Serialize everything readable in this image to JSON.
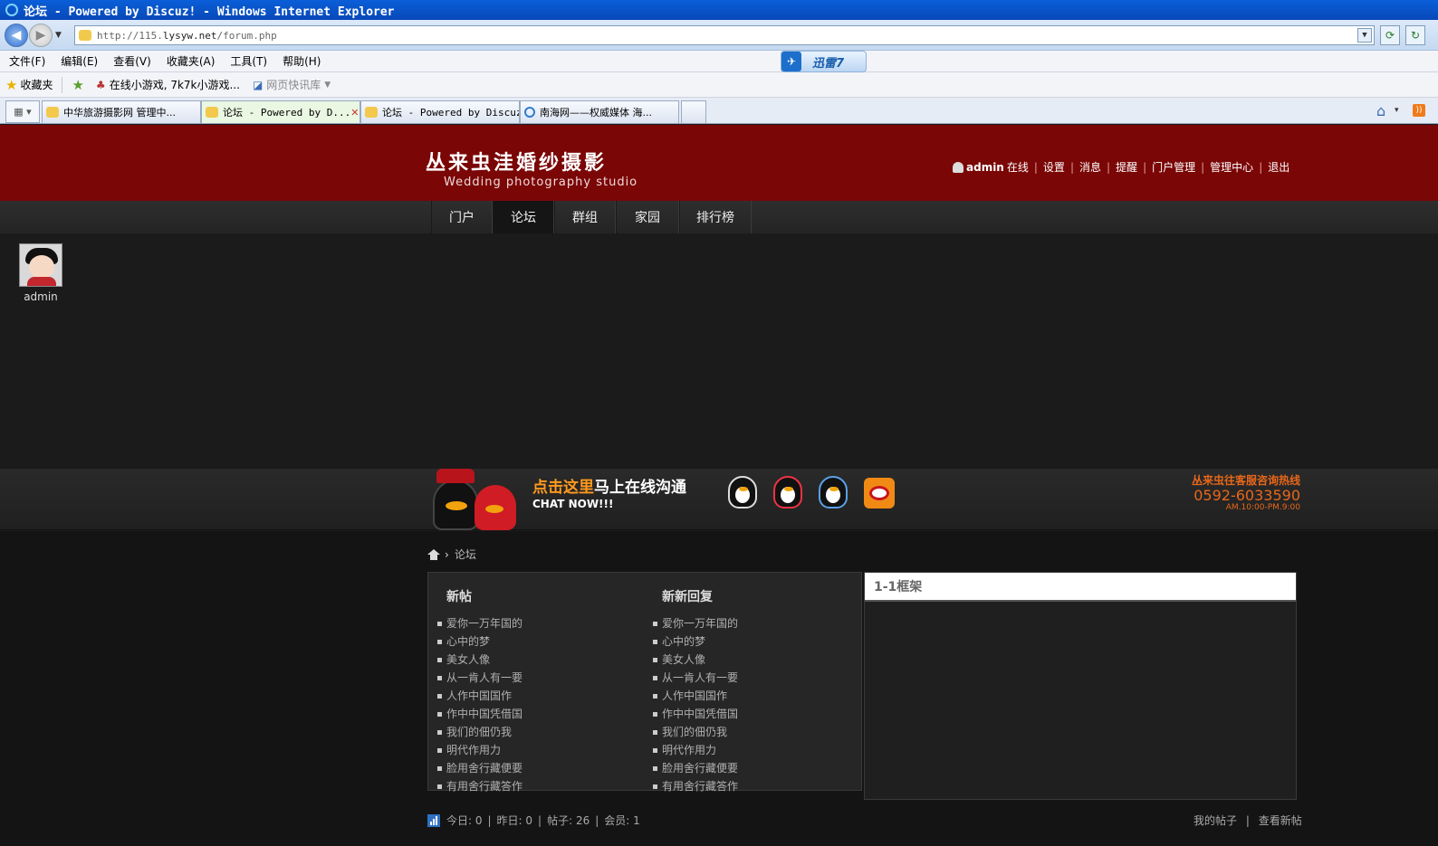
{
  "window": {
    "title": "论坛 - Powered by Discuz! - Windows Internet Explorer"
  },
  "address_bar": {
    "url_prefix": "http://115.",
    "url_domain": "lysyw.net",
    "url_path": "/forum.php"
  },
  "menu": [
    "文件(F)",
    "编辑(E)",
    "查看(V)",
    "收藏夹(A)",
    "工具(T)",
    "帮助(H)"
  ],
  "xunlei": {
    "label": "迅雷7"
  },
  "favorites_bar": {
    "favorites_label": "收藏夹",
    "item_game": "在线小游戏, 7k7k小游戏...",
    "item_webslice": "网页快讯库"
  },
  "tabs": [
    {
      "label": "中华旅游摄影网 管理中..."
    },
    {
      "label": "论坛 - Powered by D..."
    },
    {
      "label": "论坛 - Powered by Discuz!"
    },
    {
      "label": "南海网——权威媒体 海..."
    }
  ],
  "site": {
    "logo_cn": "丛来虫洼婚纱摄影",
    "logo_en": "Wedding photography studio",
    "user": {
      "name": "admin",
      "status": "在线"
    },
    "user_links": [
      "设置",
      "消息",
      "提醒",
      "门户管理",
      "管理中心",
      "退出"
    ],
    "nav": [
      "门户",
      "论坛",
      "群组",
      "家园",
      "排行榜"
    ],
    "avatar_name": "admin"
  },
  "banner": {
    "cta_orange": "点击这里",
    "cta_white": "马上在线沟通",
    "cta_en": "CHAT NOW!!!",
    "hotline_title": "丛来虫往客服咨询热线",
    "hotline_number": "0592-6033590",
    "hotline_hours": "AM.10:00-PM.9:00"
  },
  "breadcrumb": {
    "current": "论坛"
  },
  "new_posts": {
    "title": "新帖",
    "items": [
      "爱你一万年国的",
      "心中的梦",
      "美女人像",
      "从一肯人有一要",
      "人作中国国作",
      "作中中国凭借国",
      "我们的佃仍我",
      "明代作用力",
      "脸用舍行藏便要",
      "有用舍行藏答作"
    ]
  },
  "new_replies": {
    "title": "新新回复",
    "items": [
      "爱你一万年国的",
      "心中的梦",
      "美女人像",
      "从一肯人有一要",
      "人作中国国作",
      "作中中国凭借国",
      "我们的佃仍我",
      "明代作用力",
      "脸用舍行藏便要",
      "有用舍行藏答作"
    ]
  },
  "frame": {
    "title": "1-1框架"
  },
  "stats": {
    "today": "今日: 0",
    "yesterday": "昨日: 0",
    "posts": "帖子: 26",
    "members": "会员: 1"
  },
  "stats_links": {
    "my_posts": "我的帖子",
    "view_new": "查看新帖"
  }
}
